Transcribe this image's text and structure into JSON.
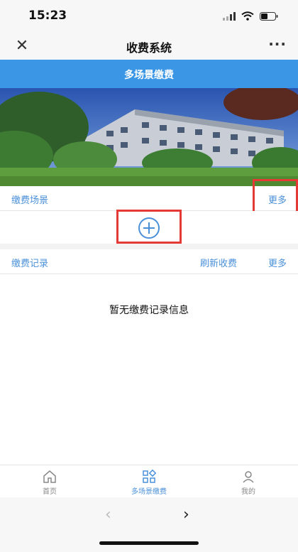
{
  "status": {
    "time": "15:23"
  },
  "nav": {
    "title": "收费系统",
    "more": "···"
  },
  "subheader": {
    "title": "多场景缴费"
  },
  "scenes": {
    "label": "缴费场景",
    "more": "更多"
  },
  "records": {
    "label": "缴费记录",
    "refresh": "刷新收费",
    "more": "更多",
    "empty": "暂无缴费记录信息"
  },
  "tabs": [
    {
      "label": "首页",
      "icon": "home-icon",
      "active": false
    },
    {
      "label": "多场景缴费",
      "icon": "grid-icon",
      "active": true
    },
    {
      "label": "我的",
      "icon": "user-icon",
      "active": false
    }
  ],
  "browser": {
    "back": "‹",
    "forward": "›"
  },
  "colors": {
    "accent": "#3b97e6",
    "link": "#4a90d9",
    "highlight": "#e53935"
  }
}
